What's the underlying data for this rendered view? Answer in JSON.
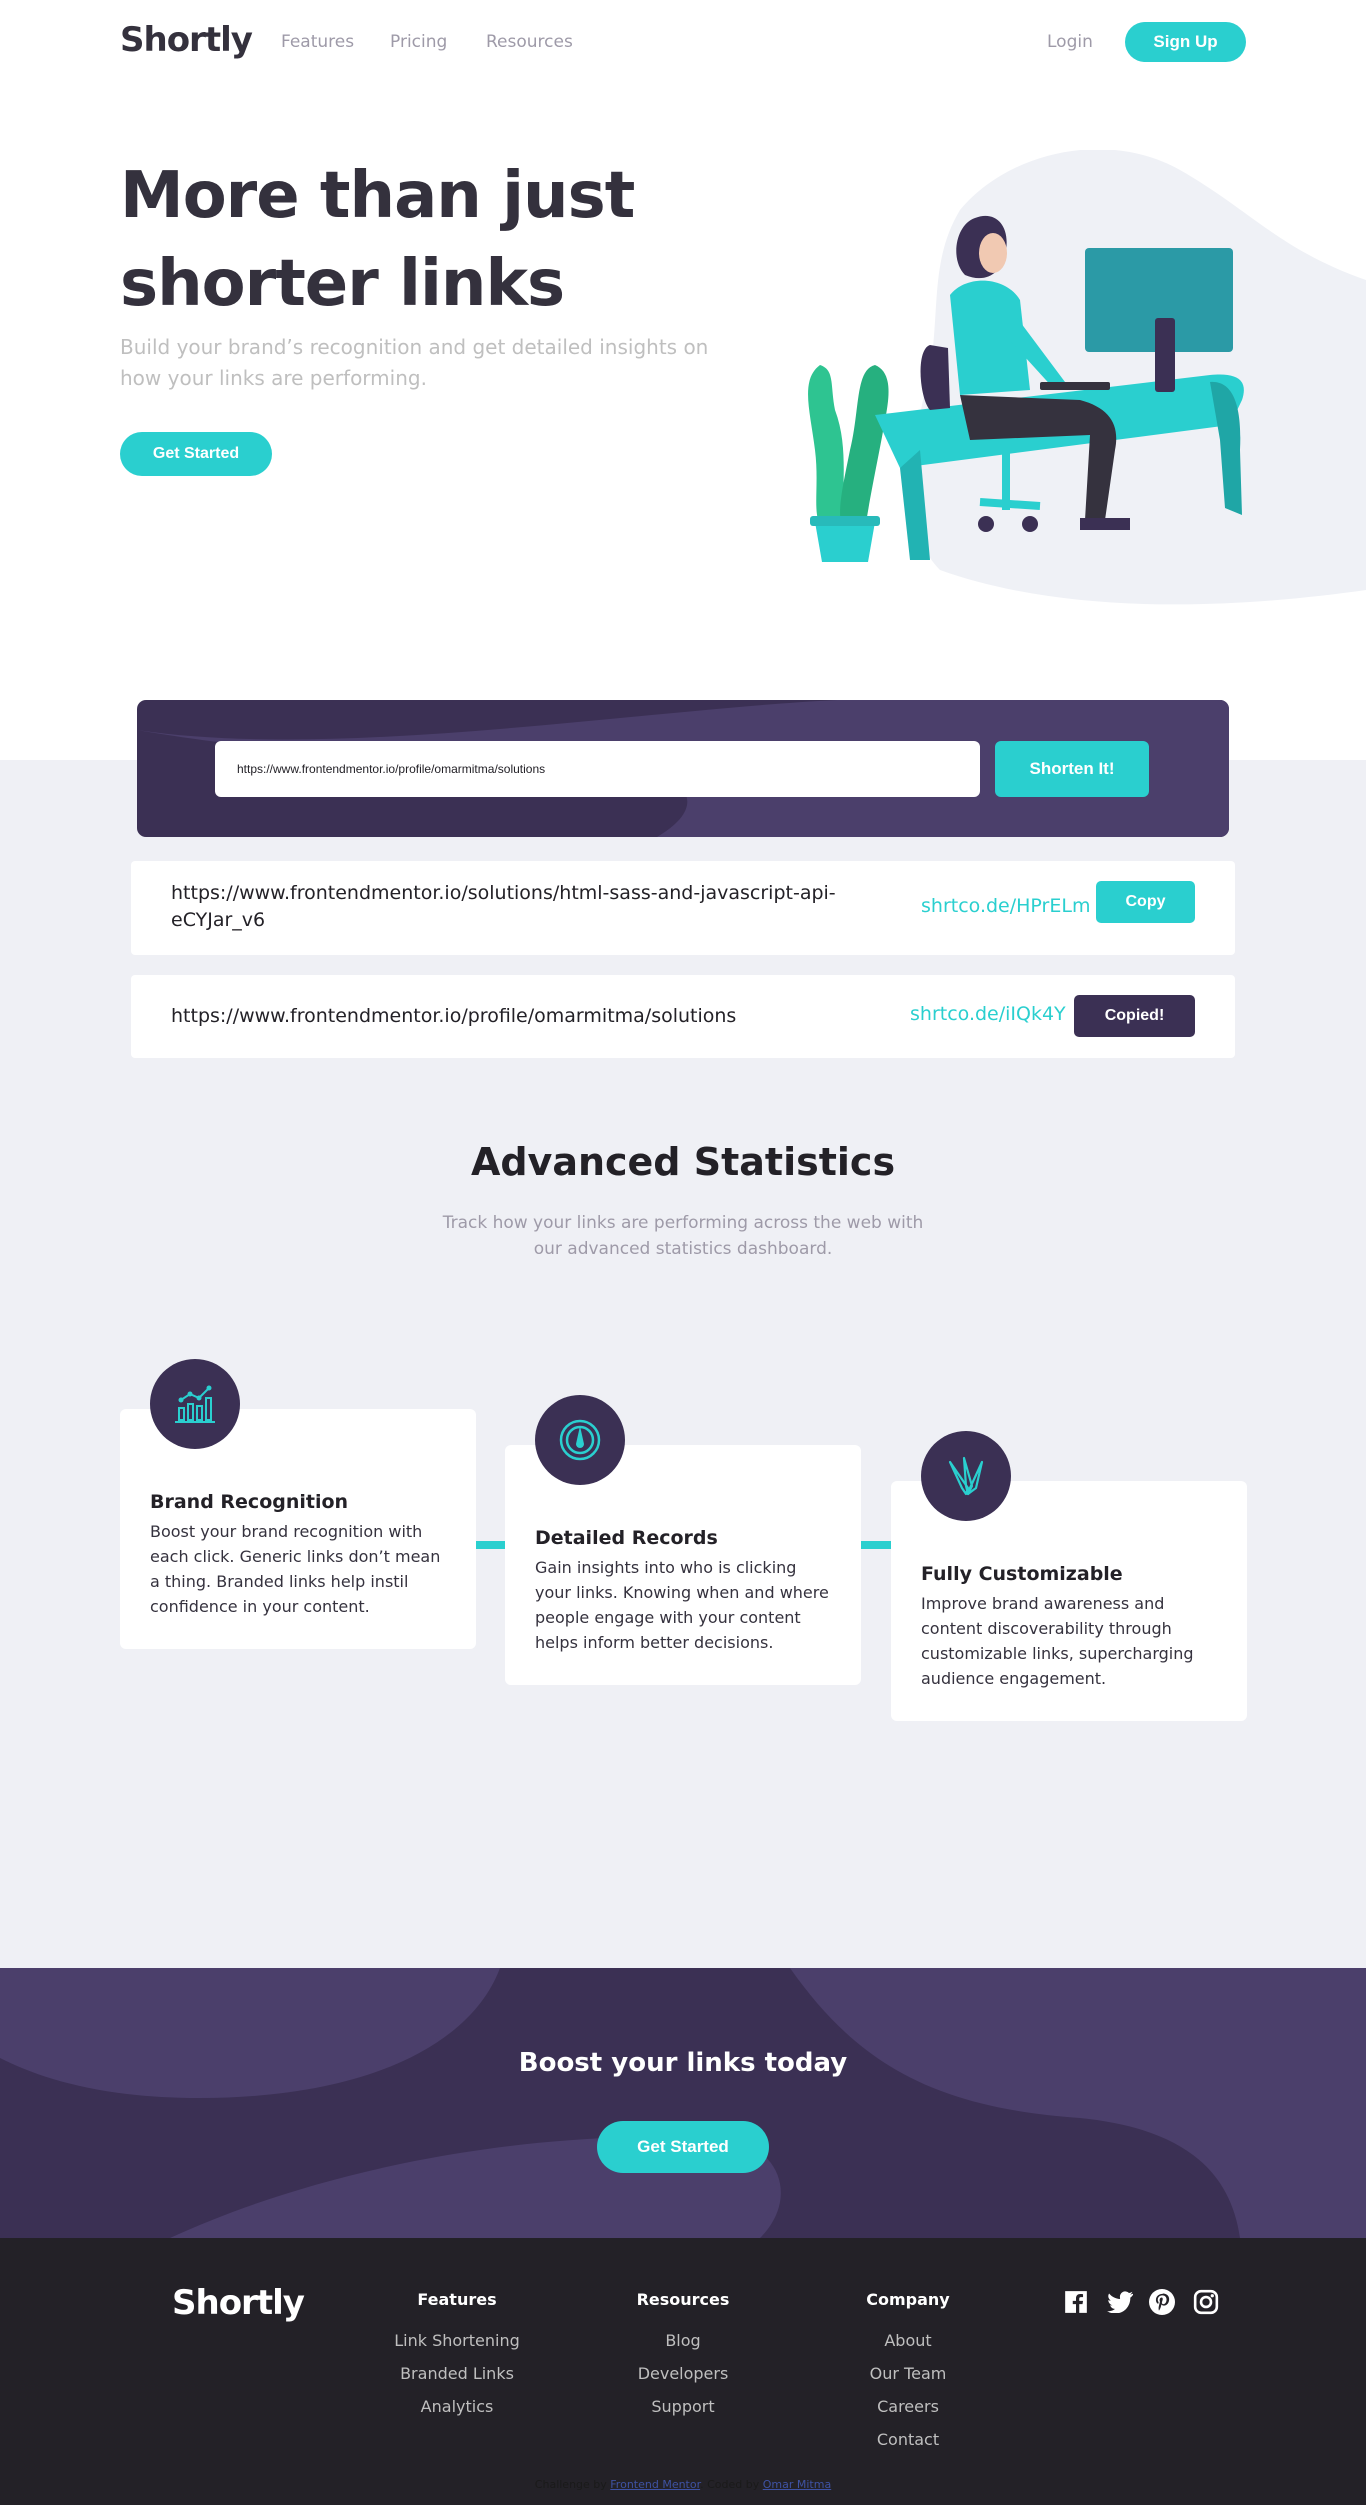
{
  "brand": {
    "logo": "Shortly",
    "accent": "#2acfcf",
    "dark_violet": "#3b3054"
  },
  "nav": {
    "links": [
      "Features",
      "Pricing",
      "Resources"
    ],
    "login": "Login",
    "signup": "Sign Up"
  },
  "hero": {
    "title": "More than just shorter links",
    "subtitle": "Build your brand’s recognition and get detailed insights on how your links are performing.",
    "cta": "Get Started"
  },
  "shorten": {
    "input_value": "https://www.frontendmentor.io/profile/omarmitma/solutions",
    "button": "Shorten It!"
  },
  "results": [
    {
      "original": "https://www.frontendmentor.io/solutions/html-sass-and-javascript-api-eCYJar_v6",
      "short": "shrtco.de/HPrELm",
      "button": "Copy",
      "copied": false
    },
    {
      "original": "https://www.frontendmentor.io/profile/omarmitma/solutions",
      "short": "shrtco.de/iIQk4Y",
      "button": "Copied!",
      "copied": true
    }
  ],
  "stats": {
    "title": "Advanced Statistics",
    "subtitle": "Track how your links are performing across the web with our advanced statistics dashboard.",
    "cards": [
      {
        "icon": "brand-recognition-icon",
        "title": "Brand Recognition",
        "text": "Boost your brand recognition with each click. Generic links don’t mean a thing. Branded links help instil confidence in your content."
      },
      {
        "icon": "detailed-records-icon",
        "title": "Detailed Records",
        "text": "Gain insights into who is clicking your links. Knowing when and where people engage with your content helps inform better decisions."
      },
      {
        "icon": "fully-customizable-icon",
        "title": "Fully Customizable",
        "text": "Improve brand awareness and content discoverability through customizable links, supercharging audience engagement."
      }
    ]
  },
  "boost": {
    "title": "Boost your links today",
    "cta": "Get Started"
  },
  "footer": {
    "logo": "Shortly",
    "columns": [
      {
        "heading": "Features",
        "links": [
          "Link Shortening",
          "Branded Links",
          "Analytics"
        ]
      },
      {
        "heading": "Resources",
        "links": [
          "Blog",
          "Developers",
          "Support"
        ]
      },
      {
        "heading": "Company",
        "links": [
          "About",
          "Our Team",
          "Careers",
          "Contact"
        ]
      }
    ],
    "social": [
      "facebook-icon",
      "twitter-icon",
      "pinterest-icon",
      "instagram-icon"
    ],
    "attribution": {
      "prefix": "Challenge by ",
      "link1": "Frontend Mentor",
      "middle": ". Coded by ",
      "link2": "Omar Mitma"
    }
  }
}
